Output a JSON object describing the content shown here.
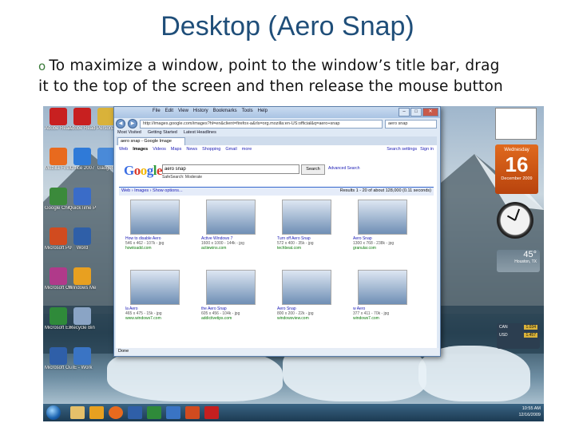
{
  "slide": {
    "title": "Desktop (Aero Snap)",
    "bullet_marker": "o",
    "bullet_line1": "To maximize a window, point to the window’s title bar, drag",
    "bullet_line2": "it to the top of the screen and then release the mouse button"
  },
  "browser": {
    "menu": [
      "File",
      "Edit",
      "View",
      "History",
      "Bookmarks",
      "Tools",
      "Help"
    ],
    "url": "http://images.google.com/images?hl=en&client=firefox-a&rls=org.mozilla:en-US:official&q=aero+snap",
    "search_value": "aero snap",
    "bookmarks": [
      "Most Visited",
      "Getting Started",
      "Latest Headlines"
    ],
    "tab_label": "aero snap - Google Image Search",
    "status": "Done"
  },
  "google": {
    "nav": [
      "Web",
      "Images",
      "Videos",
      "Maps",
      "News",
      "Shopping",
      "Gmail",
      "more"
    ],
    "nav_right": [
      "Search settings",
      "Sign in"
    ],
    "logo": "Google",
    "query": "aero snap",
    "search_button": "Search",
    "advanced": "Advanced Search",
    "safesearch": "SafeSearch: Moderate",
    "result_left": "Web  ›  Images  ›  Show options...",
    "result_right": "Results 1 - 20 of about 128,000 (0.11 seconds)",
    "thumbs": [
      {
        "cap": "How to disable Aero",
        "sub": "546 x 462 - 107k - jpg",
        "url": "howtoadd.com"
      },
      {
        "cap": "Active Windows 7",
        "sub": "1600 x 1000 - 144k - jpg",
        "url": "actiewins.com"
      },
      {
        "cap": "Turn off Aero Snap",
        "sub": "572 x 400 - 35k - jpg",
        "url": "techbeat.com"
      },
      {
        "cap": "Aero Snap",
        "sub": "1300 x 768 - 238k - jpg",
        "url": "granular.com"
      },
      {
        "cap": "la Aero",
        "sub": "465 x 475 - 15k - jpg",
        "url": "www.windows7.com"
      },
      {
        "cap": "the Aero Snap",
        "sub": "605 x 456 - 104k - jpg",
        "url": "addictivetips.com"
      },
      {
        "cap": "Aero Snap",
        "sub": "800 x 200 - 22k - jpg",
        "url": "windowsview.com"
      },
      {
        "cap": "w Aero",
        "sub": "377 x 411 - 70k - jpg",
        "url": "windows7.com"
      }
    ]
  },
  "desktop_icons": [
    "Adobe Reader",
    "Adobe Reader 8",
    "Personal",
    "Mozilla Firefox",
    "Office 2007",
    "Gadgets",
    "Google Chrome",
    "QuickTime Player",
    "",
    "Microsoft PowerPoint",
    "Word",
    "",
    "Microsoft Office Ac",
    "Windows Media",
    "",
    "Microsoft Excel",
    "Recycle Bin",
    "",
    "Microsoft Outlook",
    "IE - Work",
    ""
  ],
  "gadgets": {
    "calendar_day": "Wednesday",
    "calendar_num": "16",
    "calendar_month": "December 2009",
    "weather_temp": "45°",
    "weather_loc": "Houston, TX",
    "stock_rows": [
      {
        "name": "CAN",
        "val": "1.034"
      },
      {
        "name": "USD",
        "val": "1.457"
      }
    ]
  },
  "taskbar": {
    "time": "10:55 AM",
    "date": "12/16/2009"
  }
}
